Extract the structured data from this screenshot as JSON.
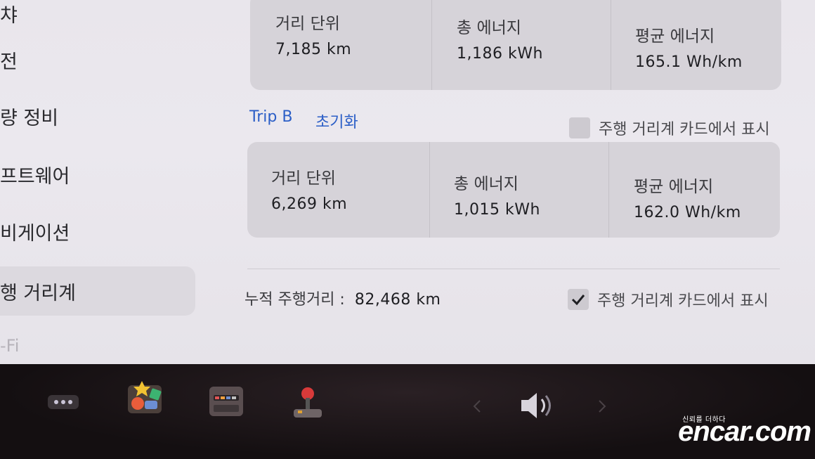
{
  "sidebar": {
    "items": [
      {
        "label": "챠"
      },
      {
        "label": "전"
      },
      {
        "label": "량 정비"
      },
      {
        "label": "프트웨어"
      },
      {
        "label": "비게이션"
      },
      {
        "label": "행 거리계"
      },
      {
        "label": "-Fi"
      }
    ]
  },
  "trip_a": {
    "distance_label": "거리 단위",
    "distance_value": "7,185 km",
    "energy_label": "총 에너지",
    "energy_value": "1,186 kWh",
    "avg_label": "평균 에너지",
    "avg_value": "165.1 Wh/km"
  },
  "trip_b": {
    "title": "Trip B",
    "reset": "초기화",
    "show_on_card": "주행 거리계 카드에서 표시",
    "distance_label": "거리 단위",
    "distance_value": "6,269 km",
    "energy_label": "총 에너지",
    "energy_value": "1,015 kWh",
    "avg_label": "평균 에너지",
    "avg_value": "162.0 Wh/km"
  },
  "odometer": {
    "label": "누적 주행거리 :",
    "value": "82,468 km",
    "show_on_card": "주행 거리계 카드에서 표시"
  },
  "watermark": {
    "tagline": "신뢰를 더하다",
    "brand": "encar.com"
  }
}
